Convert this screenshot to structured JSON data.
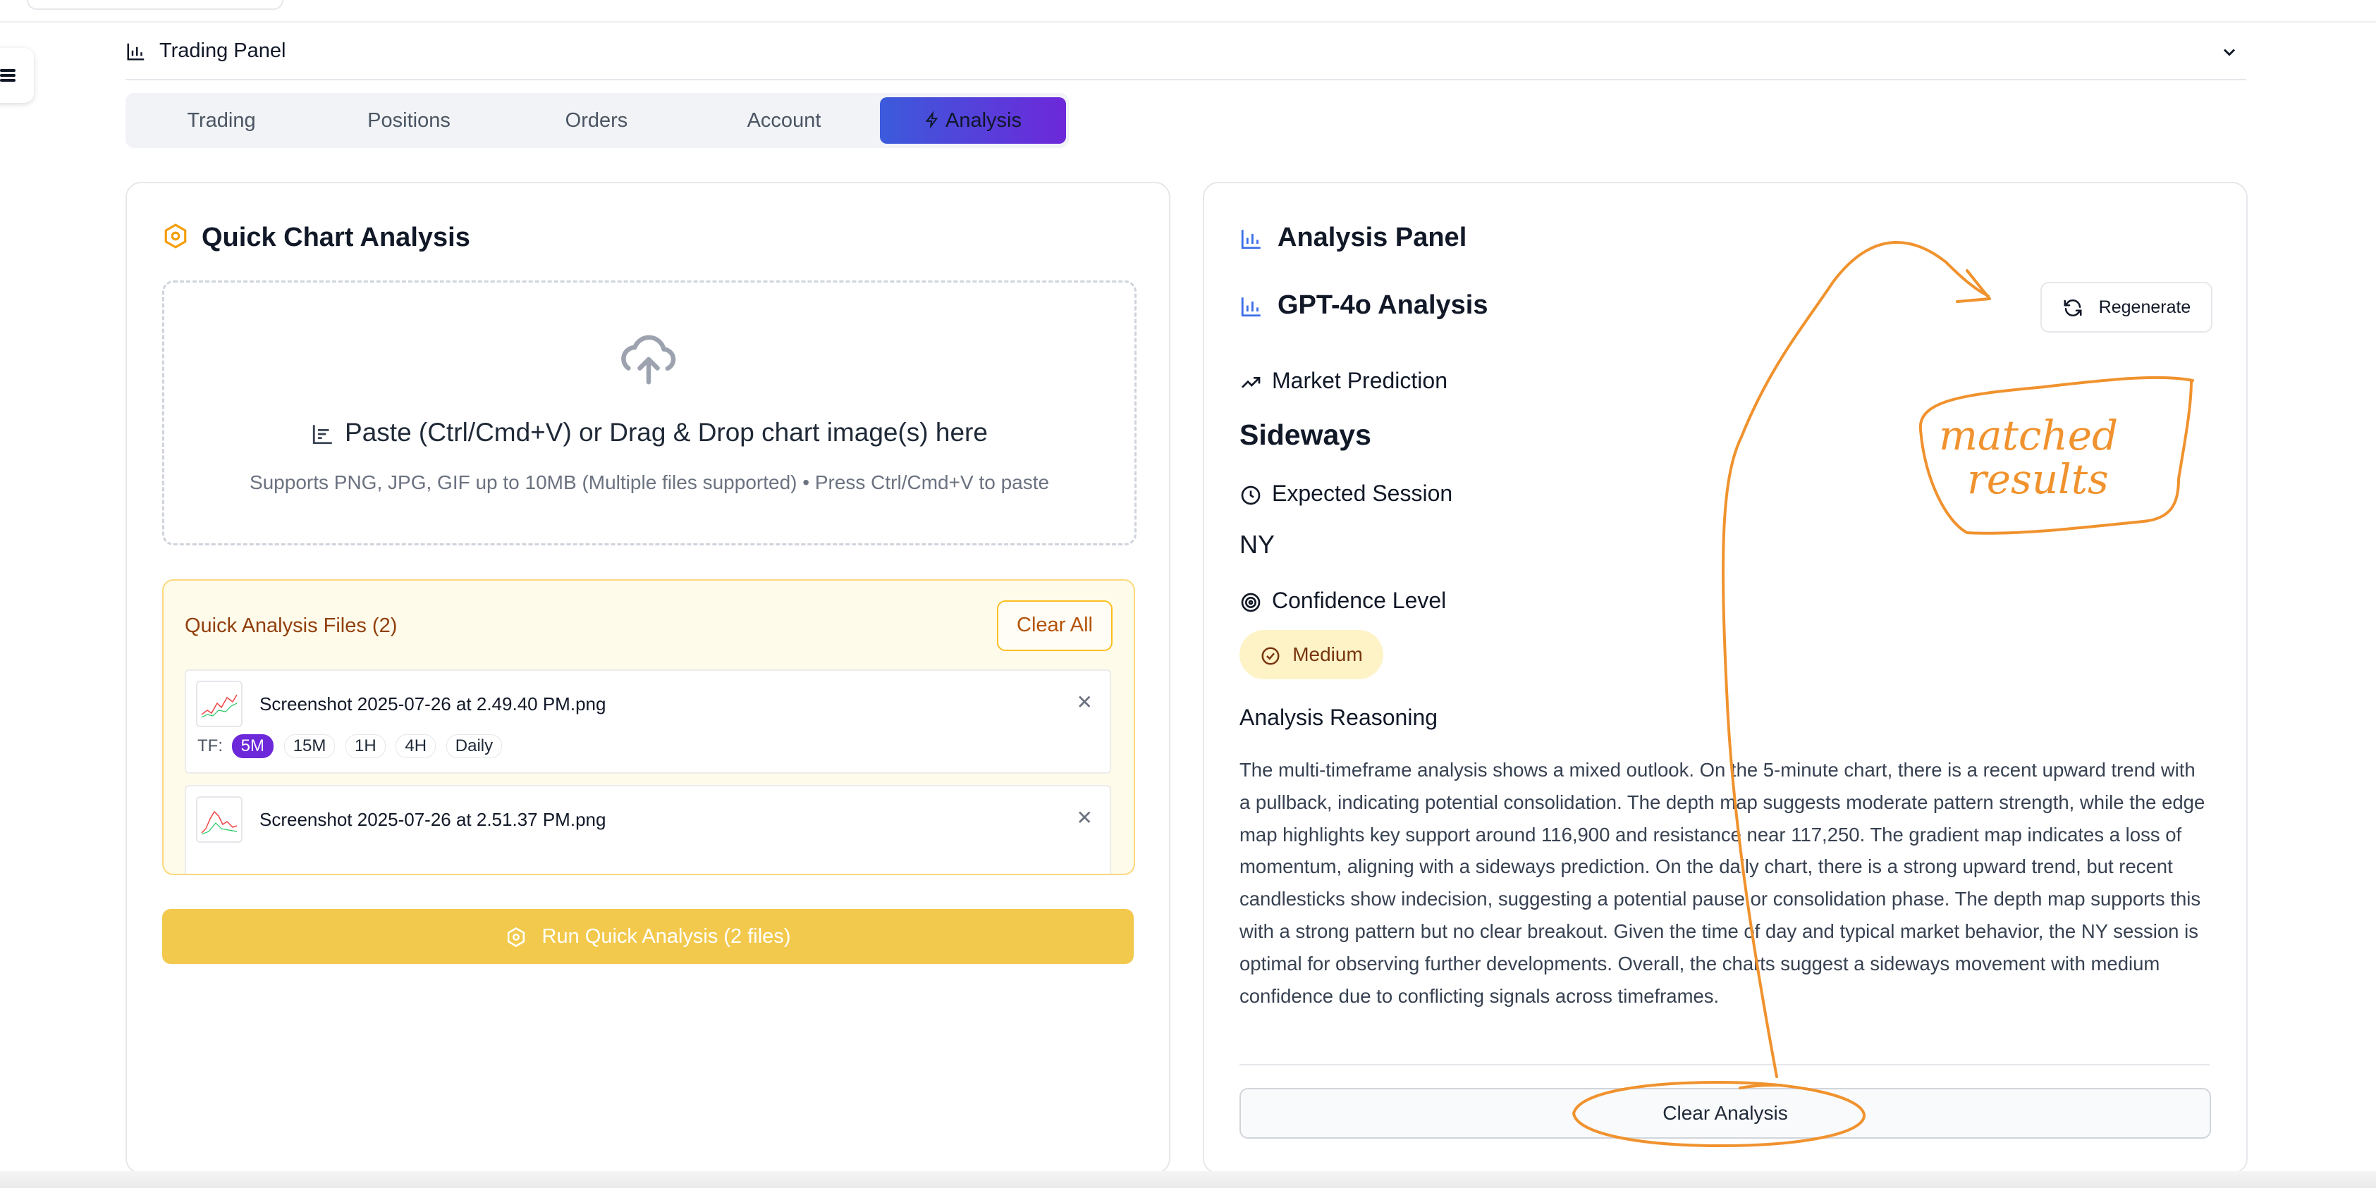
{
  "panel": {
    "title": "Trading Panel"
  },
  "tabs": [
    {
      "label": "Trading"
    },
    {
      "label": "Positions"
    },
    {
      "label": "Orders"
    },
    {
      "label": "Account"
    },
    {
      "label": "Analysis",
      "active": true
    }
  ],
  "quick": {
    "title": "Quick Chart Analysis",
    "drop_main": "Paste (Ctrl/Cmd+V) or Drag & Drop chart image(s) here",
    "drop_sub": "Supports PNG, JPG, GIF up to 10MB (Multiple files supported) • Press Ctrl/Cmd+V to paste",
    "files_title": "Quick Analysis Files (2)",
    "clear_all": "Clear All",
    "files": [
      {
        "name": "Screenshot 2025-07-26 at 2.49.40 PM.png"
      },
      {
        "name": "Screenshot 2025-07-26 at 2.51.37 PM.png"
      }
    ],
    "tf_label": "TF:",
    "timeframes": [
      "5M",
      "15M",
      "1H",
      "4H",
      "Daily"
    ],
    "selected_timeframe": "5M",
    "run_label": "Run Quick Analysis (2 files)"
  },
  "analysis": {
    "panel_title": "Analysis Panel",
    "model_title": "GPT-4o Analysis",
    "regenerate": "Regenerate",
    "prediction_label": "Market Prediction",
    "prediction_value": "Sideways",
    "session_label": "Expected Session",
    "session_value": "NY",
    "confidence_label": "Confidence Level",
    "confidence_value": "Medium",
    "reasoning_label": "Analysis Reasoning",
    "reasoning_text": "The multi-timeframe analysis shows a mixed outlook. On the 5-minute chart, there is a recent upward trend with a pullback, indicating potential consolidation. The depth map suggests moderate pattern strength, while the edge map highlights key support around 116,900 and resistance near 117,250. The gradient map indicates a loss of momentum, aligning with a sideways prediction. On the daily chart, there is a strong upward trend, but recent candlesticks show indecision, suggesting a potential pause or consolidation phase. The depth map supports this with a strong pattern but no clear breakout. Given the time of day and typical market behavior, the NY session is optimal for observing further developments. Overall, the charts suggest a sideways movement with medium confidence due to conflicting signals across timeframes.",
    "clear_label": "Clear Analysis"
  },
  "annotation": {
    "text": "matched results",
    "color": "#f0922e"
  },
  "colors": {
    "accent": "#f59e0b",
    "tab_active_start": "#3b5bdb",
    "tab_active_end": "#6d28d9",
    "run_button": "#f2c94c",
    "icon_blue": "#3b6ee8"
  }
}
